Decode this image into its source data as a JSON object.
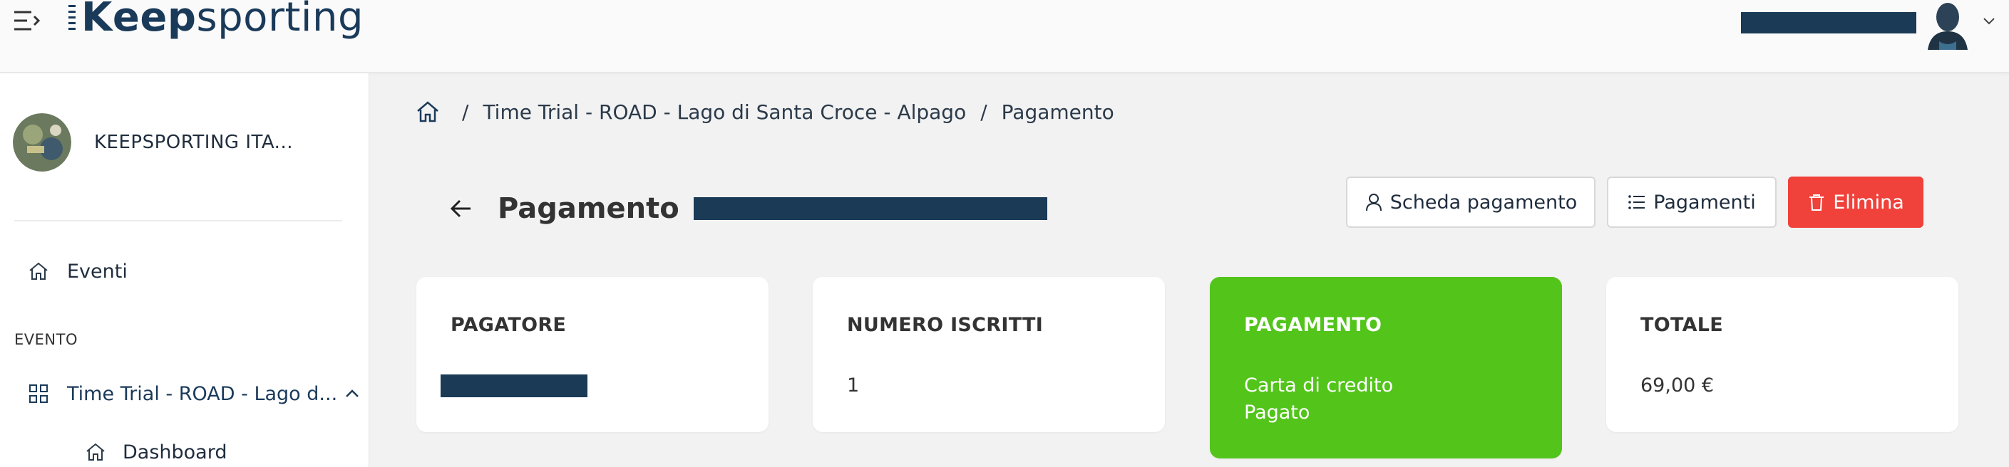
{
  "header": {
    "logo_prefix": "eep",
    "logo_suffix": "sporting",
    "colors": {
      "brand": "#1a3a5a",
      "redaction": "#1a3a55"
    }
  },
  "sidebar": {
    "org_name": "KEEPSPORTING ITA...",
    "items": [
      {
        "label": "Eventi",
        "icon": "home-icon"
      }
    ],
    "section_label": "EVENTO",
    "event_item": {
      "label": "Time Trial - ROAD - Lago d...",
      "icon": "grid-icon"
    },
    "sub_items": [
      {
        "label": "Dashboard",
        "icon": "home-icon"
      }
    ]
  },
  "breadcrumb": {
    "items": [
      "Time Trial - ROAD - Lago di Santa Croce - Alpago",
      "Pagamento"
    ],
    "separator": "/"
  },
  "page": {
    "title": "Pagamento"
  },
  "actions": {
    "scheda_label": "Scheda pagamento",
    "pagamenti_label": "Pagamenti",
    "elimina_label": "Elimina",
    "colors": {
      "danger": "#f0413a"
    }
  },
  "cards": {
    "pagatore": {
      "label": "PAGATORE"
    },
    "iscritti": {
      "label": "NUMERO ISCRITTI",
      "value": "1"
    },
    "pagamento": {
      "label": "PAGAMENTO",
      "method": "Carta di credito",
      "status": "Pagato",
      "color": "#52c41a"
    },
    "totale": {
      "label": "TOTALE",
      "value": "69,00 €"
    }
  }
}
